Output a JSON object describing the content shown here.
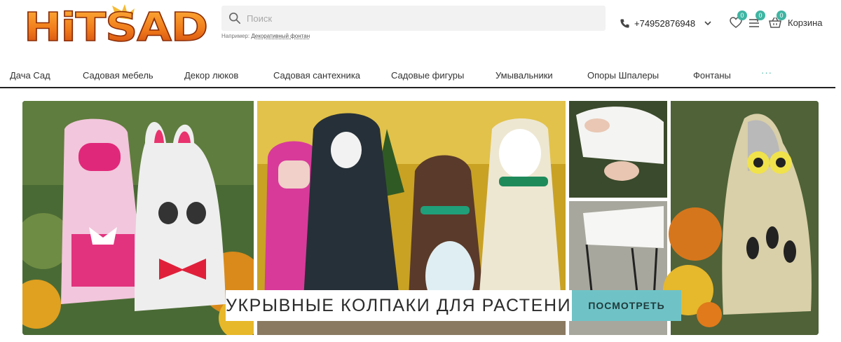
{
  "logo": {
    "text": "HiTSAD"
  },
  "search": {
    "placeholder": "Поиск",
    "example_prefix": "Например:",
    "example_link": "Декоративный фонтан"
  },
  "phone": {
    "number": "+74952876948"
  },
  "header_icons": {
    "wishlist_count": "0",
    "compare_count": "0",
    "cart_count": "0",
    "cart_label": "Корзина"
  },
  "nav": {
    "items": [
      "Дача Сад",
      "Садовая мебель",
      "Декор люков",
      "Садовая сантехника",
      "Садовые фигуры",
      "Умывальники",
      "Опоры Шпалеры",
      "Фонтаны"
    ],
    "more": "···"
  },
  "banner": {
    "title": "УКРЫВНЫЕ КОЛПАКИ ДЛЯ РАСТЕНИЙ",
    "button": "ПОСМОТРЕТЬ"
  },
  "colors": {
    "accent": "#3fb5a3",
    "banner_button": "#6fc3c6",
    "logo_orange": "#f07a1a"
  }
}
